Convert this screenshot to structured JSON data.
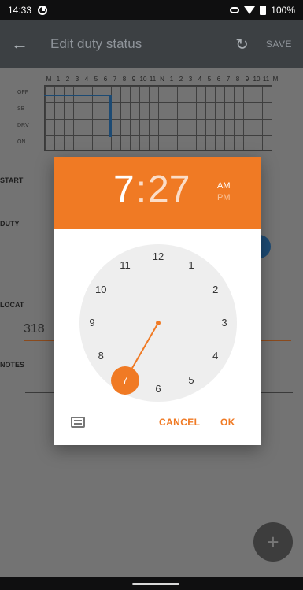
{
  "status_bar": {
    "time": "14:33",
    "battery": "100%"
  },
  "app_bar": {
    "title": "Edit duty status",
    "save_label": "SAVE"
  },
  "log_grid": {
    "hours": [
      "M",
      "1",
      "2",
      "3",
      "4",
      "5",
      "6",
      "7",
      "8",
      "9",
      "10",
      "11",
      "N",
      "1",
      "2",
      "3",
      "4",
      "5",
      "6",
      "7",
      "8",
      "9",
      "10",
      "11",
      "M"
    ],
    "rows": [
      "OFF",
      "SB",
      "DRV",
      "ON"
    ]
  },
  "form": {
    "start_label": "START",
    "duty_label": "DUTY",
    "location_label": "LOCAT",
    "location_value": "318",
    "notes_label": "NOTES"
  },
  "time_picker": {
    "hour": "7",
    "minute": "27",
    "am_label": "AM",
    "pm_label": "PM",
    "selected_period": "AM",
    "clock_numbers": [
      "12",
      "1",
      "2",
      "3",
      "4",
      "5",
      "6",
      "7",
      "8",
      "9",
      "10",
      "11"
    ],
    "selected_hour": "7",
    "cancel_label": "CANCEL",
    "ok_label": "OK",
    "accent_color": "#f07a24"
  },
  "icons": {
    "back": "arrow-left-icon",
    "refresh": "refresh-icon",
    "keyboard": "keyboard-icon",
    "fab": "plus-icon"
  }
}
